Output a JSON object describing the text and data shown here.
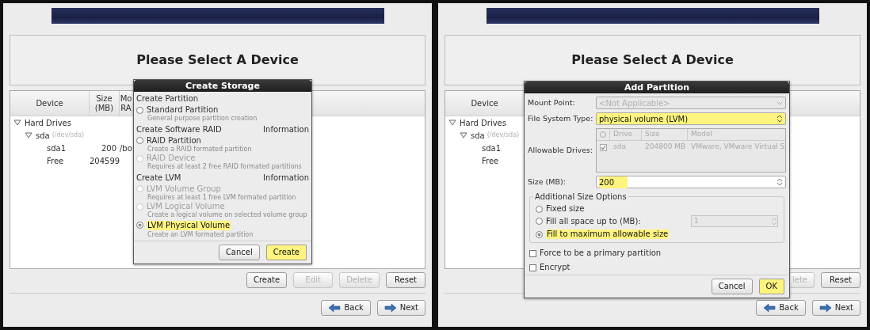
{
  "panels": [
    {
      "heading": "Please Select A Device",
      "columns": [
        "Device",
        "Size (MB)",
        "Mo RA"
      ],
      "tree": [
        {
          "label": "Hard Drives",
          "expanded": true,
          "children": [
            {
              "label": "sda",
              "note": "(/dev/sda)",
              "expanded": true,
              "children": [
                {
                  "label": "sda1",
                  "cells": [
                    "200",
                    "/bo"
                  ]
                },
                {
                  "label": "Free",
                  "cells": [
                    "204599"
                  ]
                }
              ]
            }
          ]
        }
      ],
      "actions": [
        {
          "label": "Create",
          "disabled": false
        },
        {
          "label": "Edit",
          "disabled": true
        },
        {
          "label": "Delete",
          "disabled": true
        },
        {
          "label": "Reset",
          "disabled": false
        }
      ],
      "nav": [
        {
          "label": "Back",
          "kind": "back"
        },
        {
          "label": "Next",
          "kind": "next"
        }
      ],
      "dialog": {
        "kind": "create_storage",
        "title": "Create Storage",
        "sections": [
          {
            "title": "Create Partition",
            "options": [
              {
                "label": "Standard Partition",
                "description": "General purpose partition creation",
                "disabled": false,
                "selected": false,
                "highlighted": false
              }
            ]
          },
          {
            "title": "Create Software RAID",
            "info": "Information",
            "options": [
              {
                "label": "RAID Partition",
                "description": "Create a RAID formated partition",
                "disabled": false,
                "selected": false,
                "highlighted": false
              },
              {
                "label": "RAID Device",
                "description": "Requires at least 2 free RAID formated partitions",
                "disabled": true,
                "selected": false,
                "highlighted": false
              }
            ]
          },
          {
            "title": "Create LVM",
            "info": "Information",
            "options": [
              {
                "label": "LVM Volume Group",
                "description": "Requires at least 1 free LVM formated partition",
                "disabled": true,
                "selected": false,
                "highlighted": false
              },
              {
                "label": "LVM Logical Volume",
                "description": "Create a logical volume on selected volume group",
                "disabled": true,
                "selected": false,
                "highlighted": false
              },
              {
                "label": "LVM Physical Volume",
                "description": "Create an LVM formated partition",
                "disabled": false,
                "selected": true,
                "highlighted": true
              }
            ]
          }
        ],
        "buttons": [
          {
            "label": "Cancel",
            "highlighted": false
          },
          {
            "label": "Create",
            "highlighted": true
          }
        ]
      }
    },
    {
      "heading": "Please Select A Device",
      "columns": [
        "Device"
      ],
      "tree": [
        {
          "label": "Hard Drives",
          "expanded": true,
          "children": [
            {
              "label": "sda",
              "note": "(/dev/sda)",
              "expanded": true,
              "children": [
                {
                  "label": "sda1"
                },
                {
                  "label": "Free"
                }
              ]
            }
          ]
        }
      ],
      "actions": [
        {
          "label": "lete",
          "disabled": true
        },
        {
          "label": "Reset",
          "disabled": false
        }
      ],
      "nav": [
        {
          "label": "Back",
          "kind": "back"
        },
        {
          "label": "Next",
          "kind": "next"
        }
      ],
      "dialog": {
        "kind": "add_partition",
        "title": "Add Partition",
        "mount_point": {
          "label": "Mount Point:",
          "value": "<Not Applicable>",
          "disabled": true
        },
        "file_system_type": {
          "label": "File System Type:",
          "value": "physical volume (LVM)",
          "highlighted": true
        },
        "allowable_drives": {
          "label": "Allowable Drives:",
          "columns": [
            "Drive",
            "Size",
            "Model"
          ],
          "rows": [
            {
              "checked": true,
              "cells": [
                "sda",
                "204800 MB",
                "VMware, VMware Virtual S"
              ]
            }
          ]
        },
        "size": {
          "label": "Size (MB):",
          "value": "200",
          "highlighted": true
        },
        "size_options": {
          "legend": "Additional Size Options",
          "options": [
            {
              "label": "Fixed size",
              "selected": false,
              "highlighted": false
            },
            {
              "label": "Fill all space up to (MB):",
              "selected": false,
              "highlighted": false,
              "spin_value": "1"
            },
            {
              "label": "Fill to maximum allowable size",
              "selected": true,
              "highlighted": true
            }
          ]
        },
        "checkboxes": [
          {
            "label": "Force to be a primary partition",
            "checked": false
          },
          {
            "label": "Encrypt",
            "checked": false
          }
        ],
        "buttons": [
          {
            "label": "Cancel",
            "highlighted": false
          },
          {
            "label": "OK",
            "highlighted": true
          }
        ]
      }
    }
  ]
}
